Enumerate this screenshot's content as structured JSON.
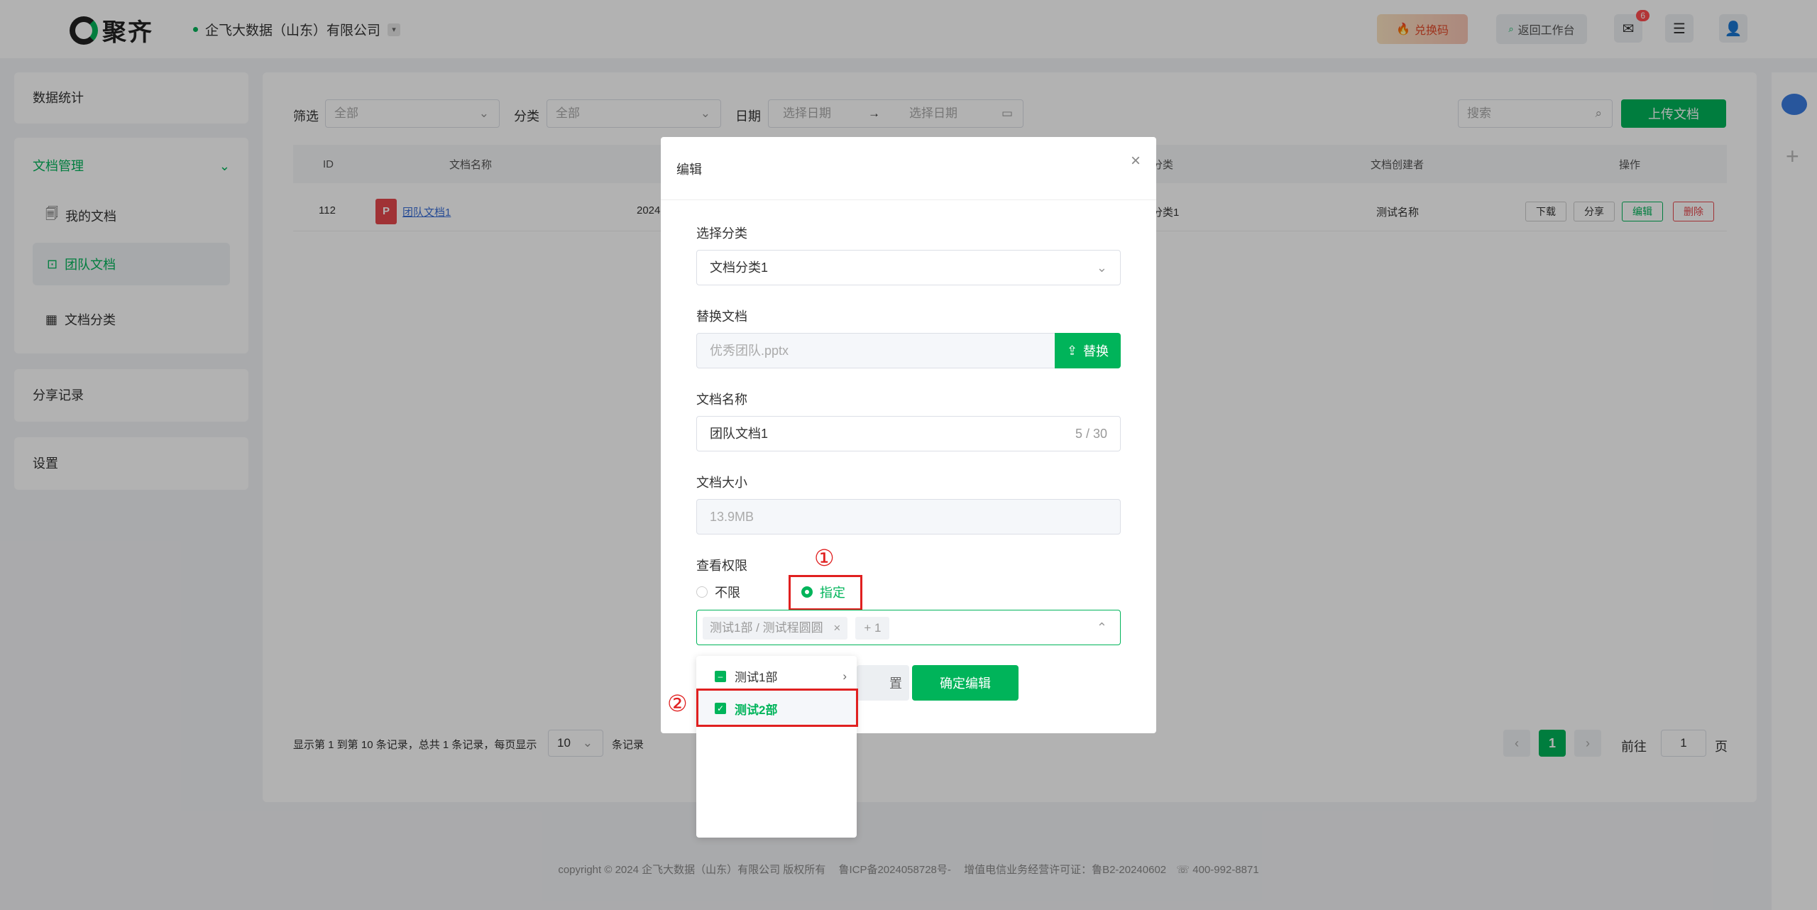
{
  "header": {
    "logo_text": "聚齐",
    "company": "企飞大数据（山东）有限公司",
    "redeem_label": "兑换码",
    "back_label": "返回工作台",
    "mail_badge": "6"
  },
  "sidebar": {
    "stats": "数据统计",
    "doc_mgmt": "文档管理",
    "my_docs": "我的文档",
    "team_docs": "团队文档",
    "doc_category": "文档分类",
    "share_records": "分享记录",
    "settings": "设置"
  },
  "filters": {
    "filter_label": "筛选",
    "filter_value": "全部",
    "category_label": "分类",
    "category_value": "全部",
    "date_label": "日期",
    "start_placeholder": "选择日期",
    "arrow": "→",
    "end_placeholder": "选择日期",
    "search_placeholder": "搜索",
    "upload_label": "上传文档"
  },
  "table": {
    "headers": {
      "id": "ID",
      "name": "文档名称",
      "category": "分类",
      "creator": "文档创建者",
      "ops": "操作"
    },
    "row": {
      "id": "112",
      "name": "团队文档1",
      "date_partial": "2024",
      "category_partial": "分类1",
      "creator": "测试名称",
      "download": "下载",
      "share": "分享",
      "edit": "编辑",
      "delete": "删除"
    }
  },
  "pagination": {
    "summary": "显示第 1 到第 10 条记录，总共 1 条记录，每页显示",
    "page_size": "10",
    "unit": "条记录",
    "current_page": "1",
    "goto_label": "前往",
    "goto_value": "1",
    "page_suffix": "页",
    "prev": "‹",
    "next": "›"
  },
  "modal": {
    "title": "编辑",
    "close": "×",
    "category_label": "选择分类",
    "category_value": "文档分类1",
    "replace_label": "替换文档",
    "replace_file": "优秀团队.pptx",
    "replace_btn": "替换",
    "name_label": "文档名称",
    "name_value": "团队文档1",
    "name_count": "5 / 30",
    "size_label": "文档大小",
    "size_value": "13.9MB",
    "perm_label": "查看权限",
    "perm_unlimited": "不限",
    "perm_specified": "指定",
    "tag1": "测试1部 / 测试程圆圆",
    "tag1_close": "×",
    "tag_more": "+ 1",
    "cancel_partial": "置",
    "confirm_btn": "确定编辑",
    "mark1": "①",
    "mark2": "②"
  },
  "dropdown": {
    "item1": "测试1部",
    "item2": "测试2部"
  },
  "footer": {
    "text": "copyright © 2024 企飞大数据（山东）有限公司 版权所有",
    "icp": "鲁ICP备2024058728号-",
    "license": "增值电信业务经营许可证：鲁B2-20240602",
    "phone": "400-992-8871"
  },
  "colors": {
    "accent": "#00b45a",
    "danger": "#e02020"
  }
}
